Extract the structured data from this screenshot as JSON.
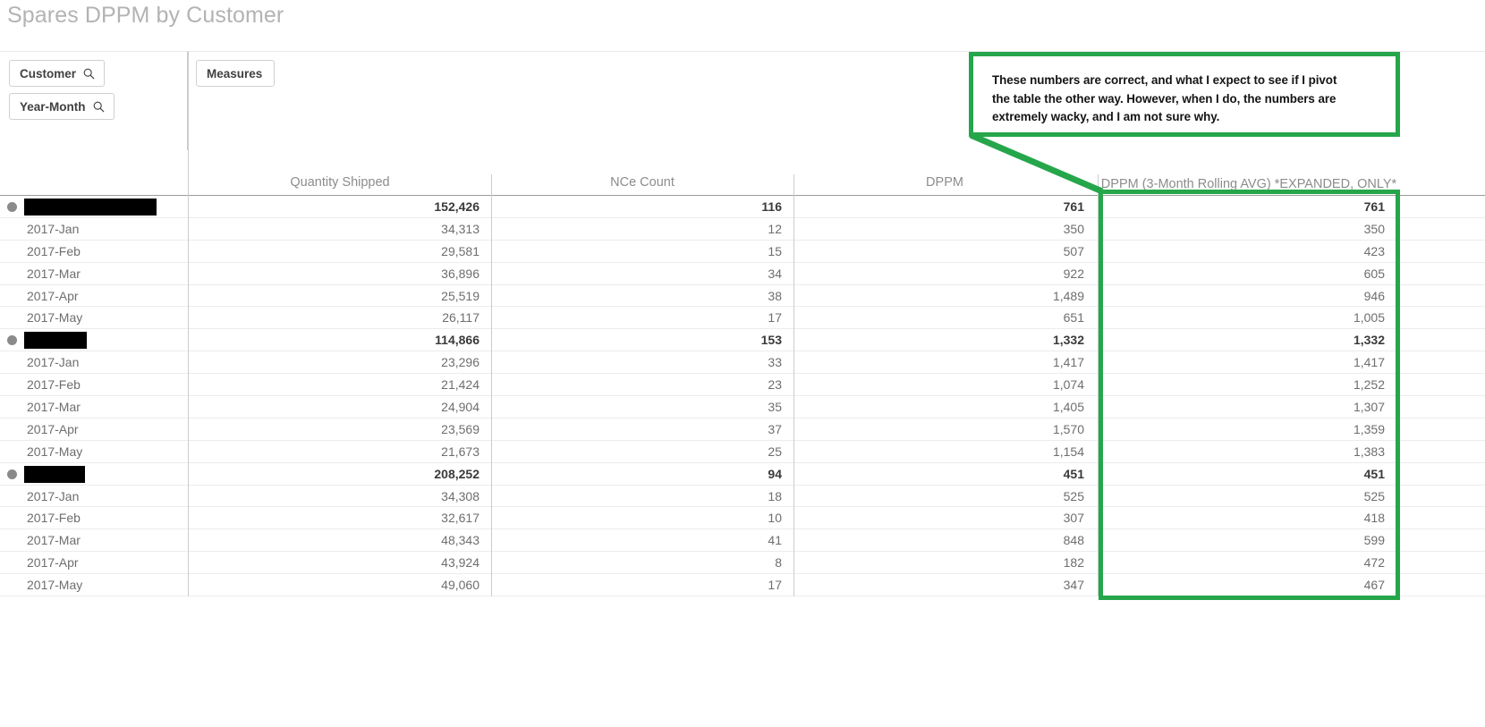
{
  "app": {
    "title": "Spares DPPM by Customer",
    "accent_green": "#26a64b",
    "header_text_color": "#8c8c8c"
  },
  "dimension_panel": {
    "items": [
      {
        "label": "Customer",
        "icon": "search-icon"
      },
      {
        "label": "Year-Month",
        "icon": "search-icon"
      }
    ]
  },
  "measure_panel": {
    "items": [
      {
        "label": "Measures"
      }
    ]
  },
  "annotation": {
    "line1": "These numbers are correct, and what I expect to see if I pivot",
    "line2": "the table the other way. However, when I do, the numbers are",
    "line3": "extremely wacky, and I am not sure why."
  },
  "table": {
    "columns": [
      {
        "key": "dim",
        "header": ""
      },
      {
        "key": "qty",
        "header": "Quantity Shipped"
      },
      {
        "key": "nce",
        "header": "NCe Count"
      },
      {
        "key": "dppm",
        "header": "DPPM"
      },
      {
        "key": "roll",
        "header": "DPPM (3-Month Rolling AVG) *EXPANDED, ONLY*"
      }
    ],
    "groups": [
      {
        "label": "",
        "redacted": true,
        "redacted_width": 148,
        "totals": {
          "qty": "152,426",
          "nce": "116",
          "dppm": "761",
          "roll": "761"
        },
        "rows": [
          {
            "label": "2017-Jan",
            "qty": "34,313",
            "nce": "12",
            "dppm": "350",
            "roll": "350"
          },
          {
            "label": "2017-Feb",
            "qty": "29,581",
            "nce": "15",
            "dppm": "507",
            "roll": "423"
          },
          {
            "label": "2017-Mar",
            "qty": "36,896",
            "nce": "34",
            "dppm": "922",
            "roll": "605"
          },
          {
            "label": "2017-Apr",
            "qty": "25,519",
            "nce": "38",
            "dppm": "1,489",
            "roll": "946"
          },
          {
            "label": "2017-May",
            "qty": "26,117",
            "nce": "17",
            "dppm": "651",
            "roll": "1,005"
          }
        ]
      },
      {
        "label": "",
        "redacted": true,
        "redacted_width": 70,
        "totals": {
          "qty": "114,866",
          "nce": "153",
          "dppm": "1,332",
          "roll": "1,332"
        },
        "rows": [
          {
            "label": "2017-Jan",
            "qty": "23,296",
            "nce": "33",
            "dppm": "1,417",
            "roll": "1,417"
          },
          {
            "label": "2017-Feb",
            "qty": "21,424",
            "nce": "23",
            "dppm": "1,074",
            "roll": "1,252"
          },
          {
            "label": "2017-Mar",
            "qty": "24,904",
            "nce": "35",
            "dppm": "1,405",
            "roll": "1,307"
          },
          {
            "label": "2017-Apr",
            "qty": "23,569",
            "nce": "37",
            "dppm": "1,570",
            "roll": "1,359"
          },
          {
            "label": "2017-May",
            "qty": "21,673",
            "nce": "25",
            "dppm": "1,154",
            "roll": "1,383"
          }
        ]
      },
      {
        "label": "",
        "redacted": true,
        "redacted_width": 68,
        "totals": {
          "qty": "208,252",
          "nce": "94",
          "dppm": "451",
          "roll": "451"
        },
        "rows": [
          {
            "label": "2017-Jan",
            "qty": "34,308",
            "nce": "18",
            "dppm": "525",
            "roll": "525"
          },
          {
            "label": "2017-Feb",
            "qty": "32,617",
            "nce": "10",
            "dppm": "307",
            "roll": "418"
          },
          {
            "label": "2017-Mar",
            "qty": "48,343",
            "nce": "41",
            "dppm": "848",
            "roll": "599"
          },
          {
            "label": "2017-Apr",
            "qty": "43,924",
            "nce": "8",
            "dppm": "182",
            "roll": "472"
          },
          {
            "label": "2017-May",
            "qty": "49,060",
            "nce": "17",
            "dppm": "347",
            "roll": "467"
          }
        ]
      }
    ]
  }
}
